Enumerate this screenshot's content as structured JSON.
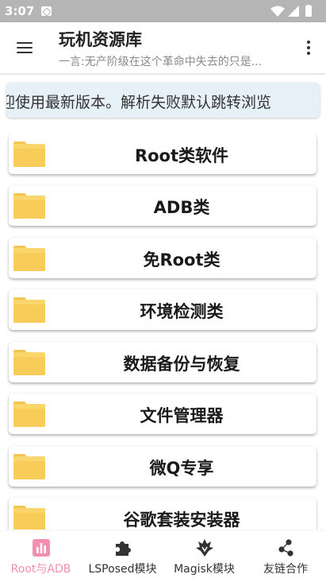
{
  "status_bar": {
    "time": "3:07"
  },
  "app_bar": {
    "title": "玩机资源库",
    "subtitle": "一言:无产阶级在这个革命中失去的只是..."
  },
  "announcement": {
    "text": "迎使用最新版本。解析失败默认跳转浏览"
  },
  "list": {
    "items": [
      {
        "label": "Root类软件"
      },
      {
        "label": "ADB类"
      },
      {
        "label": "免Root类"
      },
      {
        "label": "环境检测类"
      },
      {
        "label": "数据备份与恢复"
      },
      {
        "label": "文件管理器"
      },
      {
        "label": "微Q专享"
      },
      {
        "label": "谷歌套装安装器"
      }
    ]
  },
  "bottom_nav": {
    "items": [
      {
        "label": "Root与ADB",
        "icon": "bar-chart-icon",
        "active": true
      },
      {
        "label": "LSPosed模块",
        "icon": "puzzle-icon",
        "active": false
      },
      {
        "label": "Magisk模块",
        "icon": "magisk-icon",
        "active": false
      },
      {
        "label": "友链合作",
        "icon": "share-nodes-icon",
        "active": false
      }
    ]
  },
  "colors": {
    "accent": "#f48fb1",
    "status_bar": "#b5b5b5",
    "folder": "#f9d66c",
    "announcement_bg": "#e6f0f7",
    "nav_inactive": "#333333"
  }
}
